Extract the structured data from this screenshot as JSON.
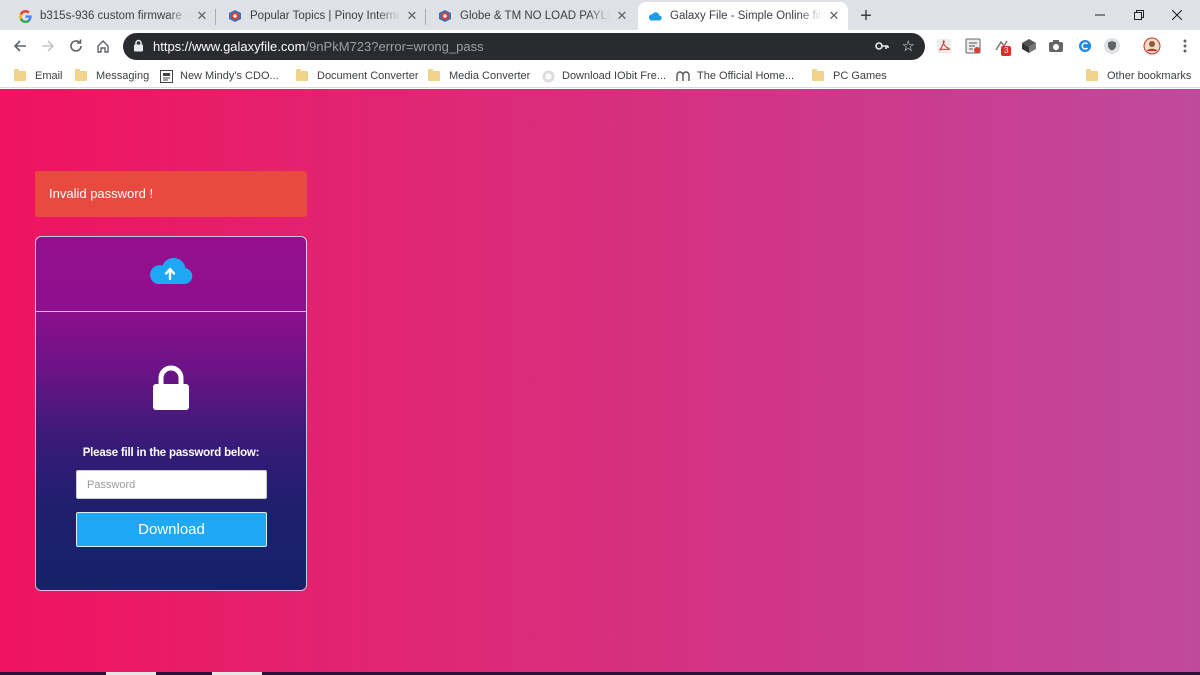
{
  "browser": {
    "tabs": [
      {
        "title": "b315s-936 custom firmware - Go",
        "icon": "google-icon"
      },
      {
        "title": "Popular Topics | Pinoy Internet ar",
        "icon": "pinoy-forum-icon"
      },
      {
        "title": "Globe & TM NO LOAD PAYLOAD",
        "icon": "pinoy-forum-icon"
      },
      {
        "title": "Galaxy File - Simple Online file st",
        "icon": "cloud-icon",
        "active": true
      }
    ],
    "url_host": "https://www.galaxyfile.com",
    "url_path": "/9nPkM723?error=wrong_pass",
    "ext_badge": "3",
    "bookmarks": [
      {
        "label": "Email",
        "icon": "folder-icon"
      },
      {
        "label": "Messaging",
        "icon": "folder-icon"
      },
      {
        "label": "New Mindy's CDO...",
        "icon": "page-icon"
      },
      {
        "label": "Document Converter",
        "icon": "folder-icon"
      },
      {
        "label": "Media Converter",
        "icon": "folder-icon"
      },
      {
        "label": "Download IObit Fre...",
        "icon": "iobit-icon"
      },
      {
        "label": "The Official Home...",
        "icon": "home-logo-icon"
      },
      {
        "label": "PC Games",
        "icon": "folder-icon"
      }
    ],
    "other_bookmarks": "Other bookmarks"
  },
  "page": {
    "alert": "Invalid password !",
    "prompt": "Please fill in the password below:",
    "password_placeholder": "Password",
    "password_value": "",
    "download_label": "Download",
    "colors": {
      "background_start": "#f0135f",
      "background_end": "#bf4a9d",
      "alert": "#e84a3f",
      "card_top": "#950f8c",
      "card_bottom": "#16216a",
      "button": "#1fa8f5"
    }
  }
}
